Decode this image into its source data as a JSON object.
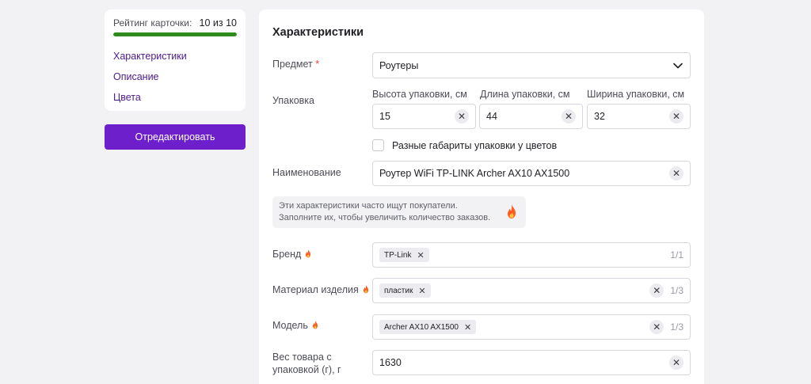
{
  "sidebar": {
    "rating_label": "Рейтинг карточки:",
    "rating_value": "10 из 10",
    "rating_progress": 1.0,
    "links": [
      "Характеристики",
      "Описание",
      "Цвета"
    ],
    "edit_button": "Отредактировать"
  },
  "main": {
    "title": "Характеристики",
    "subject": {
      "label": "Предмет",
      "required_mark": "*",
      "value": "Роутеры"
    },
    "package": {
      "label": "Упаковка",
      "height": {
        "label": "Высота упаковки, см",
        "value": "15"
      },
      "length": {
        "label": "Длина упаковки, см",
        "value": "44"
      },
      "width": {
        "label": "Ширина упаковки, см",
        "value": "32"
      },
      "checkbox_label": "Разные габариты упаковки у цветов"
    },
    "name": {
      "label": "Наименование",
      "value": "Роутер WiFi TP-LINK Archer AX10 AX1500"
    },
    "hint": {
      "line1": "Эти характеристики часто ищут покупатели.",
      "line2": "Заполните их, чтобы увеличить количество заказов."
    },
    "brand": {
      "label": "Бренд",
      "tag": "TP-Link",
      "count": "1/1"
    },
    "material": {
      "label": "Материал изделия",
      "tag": "пластик",
      "count": "1/3"
    },
    "model": {
      "label": "Модель",
      "tag": "Archer AX10 AX1500",
      "count": "1/3"
    },
    "weight": {
      "label_line1": "Вес товара с",
      "label_line2": "упаковкой (г), г",
      "value": "1630"
    }
  },
  "colors": {
    "accent": "#6c1fcb",
    "link": "#4a1a8c",
    "progress": "#2f8a1e",
    "required": "#f03b3b",
    "fire": "#ff5a1f"
  },
  "icons": [
    "chevron-down-icon",
    "clear-icon",
    "fire-icon",
    "remove-tag-icon"
  ]
}
